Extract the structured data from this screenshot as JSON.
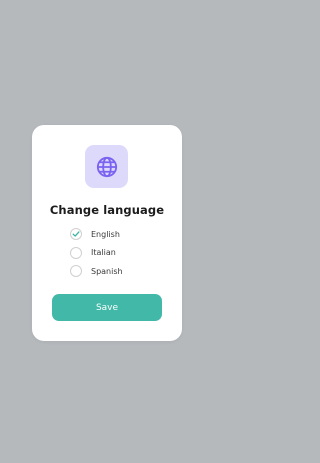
{
  "dialog": {
    "icon": "globe-icon",
    "title": "Change language",
    "options": [
      {
        "label": "English",
        "checked": true
      },
      {
        "label": "Italian",
        "checked": false
      },
      {
        "label": "Spanish",
        "checked": false
      }
    ],
    "save_label": "Save"
  },
  "colors": {
    "background": "#b5b9bc",
    "card": "#ffffff",
    "icon_tile": "#ddd9fb",
    "icon_accent": "#7a63f0",
    "check_accent": "#3ab3a4",
    "button": "#42b8a8"
  }
}
